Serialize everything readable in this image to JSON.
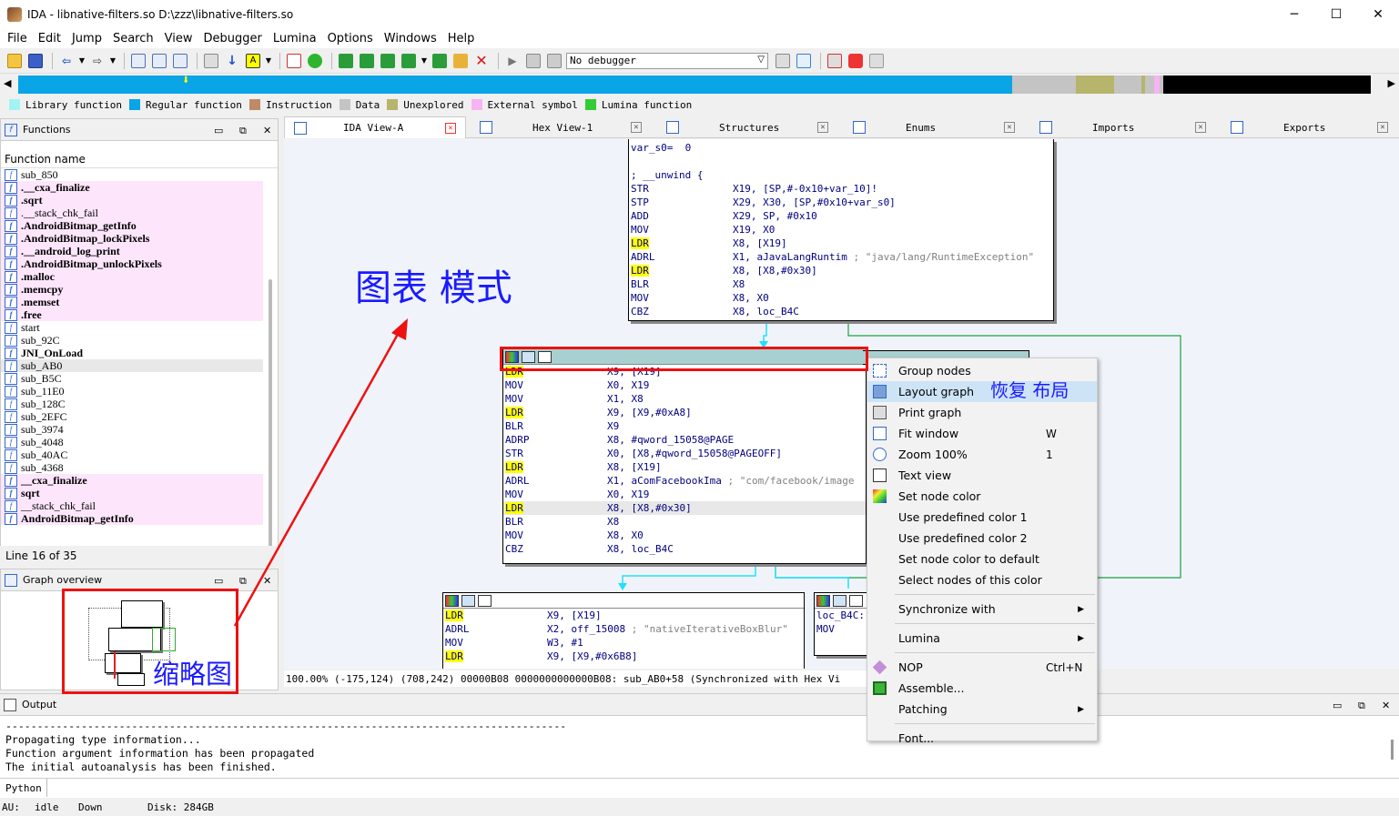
{
  "window": {
    "title": "IDA - libnative-filters.so D:\\zzz\\libnative-filters.so",
    "minimize": "─",
    "maximize": "☐",
    "close": "✕"
  },
  "menu": [
    "File",
    "Edit",
    "Jump",
    "Search",
    "View",
    "Debugger",
    "Lumina",
    "Options",
    "Windows",
    "Help"
  ],
  "toolbar": {
    "debugger_select": "No debugger"
  },
  "navband": {
    "colors": {
      "regular": "#0aa5e6",
      "library": "#a3f3f4",
      "data": "#c4c4c4",
      "unexplored": "#b7b46c",
      "external": "#f7b3f3",
      "black": "#000000"
    }
  },
  "legend": [
    {
      "label": "Library function",
      "color": "#a3f3f4"
    },
    {
      "label": "Regular function",
      "color": "#0aa5e6"
    },
    {
      "label": "Instruction",
      "color": "#c08a68"
    },
    {
      "label": "Data",
      "color": "#c4c4c4"
    },
    {
      "label": "Unexplored",
      "color": "#b7b46c"
    },
    {
      "label": "External symbol",
      "color": "#f7b3f3"
    },
    {
      "label": "Lumina function",
      "color": "#33cc33"
    }
  ],
  "tabs": [
    {
      "label": "IDA View-A",
      "active": true
    },
    {
      "label": "Hex View-1",
      "active": false
    },
    {
      "label": "Structures",
      "active": false
    },
    {
      "label": "Enums",
      "active": false
    },
    {
      "label": "Imports",
      "active": false
    },
    {
      "label": "Exports",
      "active": false
    }
  ],
  "functions_panel": {
    "title": "Functions",
    "column": "Function name",
    "items": [
      {
        "name": "sub_850",
        "style": ""
      },
      {
        "name": ".__cxa_finalize",
        "style": "pink b"
      },
      {
        "name": ".sqrt",
        "style": "pink b"
      },
      {
        "name": ".__stack_chk_fail",
        "style": "pink"
      },
      {
        "name": ".AndroidBitmap_getInfo",
        "style": "pink b"
      },
      {
        "name": ".AndroidBitmap_lockPixels",
        "style": "pink b"
      },
      {
        "name": ".__android_log_print",
        "style": "pink b"
      },
      {
        "name": ".AndroidBitmap_unlockPixels",
        "style": "pink b"
      },
      {
        "name": ".malloc",
        "style": "pink b"
      },
      {
        "name": ".memcpy",
        "style": "pink b"
      },
      {
        "name": ".memset",
        "style": "pink b"
      },
      {
        "name": ".free",
        "style": "pink b"
      },
      {
        "name": "start",
        "style": ""
      },
      {
        "name": "sub_92C",
        "style": ""
      },
      {
        "name": "JNI_OnLoad",
        "style": "b"
      },
      {
        "name": "sub_AB0",
        "style": "sel"
      },
      {
        "name": "sub_B5C",
        "style": ""
      },
      {
        "name": "sub_11E0",
        "style": ""
      },
      {
        "name": "sub_128C",
        "style": ""
      },
      {
        "name": "sub_2EFC",
        "style": ""
      },
      {
        "name": "sub_3974",
        "style": ""
      },
      {
        "name": "sub_4048",
        "style": ""
      },
      {
        "name": "sub_40AC",
        "style": ""
      },
      {
        "name": "sub_4368",
        "style": ""
      },
      {
        "name": "__cxa_finalize",
        "style": "pink b"
      },
      {
        "name": "sqrt",
        "style": "pink b"
      },
      {
        "name": "__stack_chk_fail",
        "style": "pink"
      },
      {
        "name": "AndroidBitmap_getInfo",
        "style": "pink b"
      }
    ],
    "line_info": "Line 16 of 35"
  },
  "overview_panel": {
    "title": "Graph overview"
  },
  "graph": {
    "node_top": {
      "lines": [
        {
          "mn": "var_s0=  0",
          "ops": "",
          "cmt": "",
          "hl": false,
          "raw": true
        },
        {
          "mn": "",
          "ops": "",
          "cmt": "",
          "hl": false,
          "raw": true
        },
        {
          "mn": "; __unwind {",
          "ops": "",
          "cmt": "",
          "hl": false,
          "raw": true
        },
        {
          "mn": "STR",
          "ops": "X19, [SP,#-0x10+var_10]!",
          "cmt": "",
          "hl": false
        },
        {
          "mn": "STP",
          "ops": "X29, X30, [SP,#0x10+var_s0]",
          "cmt": "",
          "hl": false
        },
        {
          "mn": "ADD",
          "ops": "X29, SP, #0x10",
          "cmt": "",
          "hl": false
        },
        {
          "mn": "MOV",
          "ops": "X19, X0",
          "cmt": "",
          "hl": false
        },
        {
          "mn": "LDR",
          "ops": "X8, [X19]",
          "cmt": "",
          "hl": true
        },
        {
          "mn": "ADRL",
          "ops": "X1, aJavaLangRuntim",
          "cmt": " ; \"java/lang/RuntimeException\"",
          "hl": false
        },
        {
          "mn": "LDR",
          "ops": "X8, [X8,#0x30]",
          "cmt": "",
          "hl": true
        },
        {
          "mn": "BLR",
          "ops": "X8",
          "cmt": "",
          "hl": false
        },
        {
          "mn": "MOV",
          "ops": "X8, X0",
          "cmt": "",
          "hl": false
        },
        {
          "mn": "CBZ",
          "ops": "X8, loc_B4C",
          "cmt": "",
          "hl": false
        }
      ]
    },
    "node_mid": {
      "lines": [
        {
          "mn": "LDR",
          "ops": "X9, [X19]",
          "cmt": "",
          "hl": true
        },
        {
          "mn": "MOV",
          "ops": "X0, X19",
          "cmt": "",
          "hl": false
        },
        {
          "mn": "MOV",
          "ops": "X1, X8",
          "cmt": "",
          "hl": false
        },
        {
          "mn": "LDR",
          "ops": "X9, [X9,#0xA8]",
          "cmt": "",
          "hl": true
        },
        {
          "mn": "BLR",
          "ops": "X9",
          "cmt": "",
          "hl": false
        },
        {
          "mn": "ADRP",
          "ops": "X8, #qword_15058@PAGE",
          "cmt": "",
          "hl": false
        },
        {
          "mn": "STR",
          "ops": "X0, [X8,#qword_15058@PAGEOFF]",
          "cmt": "",
          "hl": false
        },
        {
          "mn": "LDR",
          "ops": "X8, [X19]",
          "cmt": "",
          "hl": true
        },
        {
          "mn": "ADRL",
          "ops": "X1, aComFacebookIma",
          "cmt": " ; \"com/facebook/image",
          "hl": false
        },
        {
          "mn": "MOV",
          "ops": "X0, X19",
          "cmt": "",
          "hl": false
        },
        {
          "mn": "LDR",
          "ops": "X8, [X8,#0x30]",
          "cmt": "",
          "hl": true,
          "gray": true
        },
        {
          "mn": "BLR",
          "ops": "X8",
          "cmt": "",
          "hl": false
        },
        {
          "mn": "MOV",
          "ops": "X8, X0",
          "cmt": "",
          "hl": false
        },
        {
          "mn": "CBZ",
          "ops": "X8, loc_B4C",
          "cmt": "",
          "hl": false
        }
      ]
    },
    "node_bl": {
      "lines": [
        {
          "mn": "LDR",
          "ops": "X9, [X19]",
          "cmt": "",
          "hl": true
        },
        {
          "mn": "ADRL",
          "ops": "X2, off_15008",
          "cmt": " ; \"nativeIterativeBoxBlur\"",
          "hl": false
        },
        {
          "mn": "MOV",
          "ops": "W3, #1",
          "cmt": "",
          "hl": false
        },
        {
          "mn": "LDR",
          "ops": "X9, [X9,#0x6B8]",
          "cmt": "",
          "hl": true
        }
      ]
    },
    "node_br": {
      "lines": [
        {
          "mn": "loc_B4C:",
          "ops": "",
          "cmt": "",
          "hl": false,
          "raw": true
        },
        {
          "mn": "MOV",
          "ops": "",
          "cmt": "",
          "hl": false,
          "raw": true
        }
      ]
    },
    "status": "100.00% (-175,124) (708,242) 00000B08 0000000000000B08: sub_AB0+58 (Synchronized with Hex Vi"
  },
  "context_menu": [
    {
      "label": "Group nodes",
      "icon": "group-nodes-icon",
      "shortcut": "",
      "sub": false
    },
    {
      "label": "Layout graph",
      "icon": "layout-graph-icon",
      "shortcut": "",
      "sub": false,
      "hover": true
    },
    {
      "label": "Print graph",
      "icon": "printer-icon",
      "shortcut": "",
      "sub": false
    },
    {
      "label": "Fit window",
      "icon": "fit-window-icon",
      "shortcut": "W",
      "sub": false
    },
    {
      "label": "Zoom 100%",
      "icon": "zoom-icon",
      "shortcut": "1",
      "sub": false
    },
    {
      "label": "Text view",
      "icon": "text-view-icon",
      "shortcut": "",
      "sub": false
    },
    {
      "label": "Set node color",
      "icon": "color-palette-icon",
      "shortcut": "",
      "sub": false
    },
    {
      "label": "Use predefined color 1",
      "icon": "",
      "shortcut": "",
      "sub": false
    },
    {
      "label": "Use predefined color 2",
      "icon": "",
      "shortcut": "",
      "sub": false
    },
    {
      "label": "Set node color to default",
      "icon": "",
      "shortcut": "",
      "sub": false
    },
    {
      "label": "Select nodes of this color",
      "icon": "",
      "shortcut": "",
      "sub": false,
      "sep_after": true
    },
    {
      "label": "Synchronize with",
      "icon": "",
      "shortcut": "",
      "sub": true,
      "sep_after": true
    },
    {
      "label": "Lumina",
      "icon": "",
      "shortcut": "",
      "sub": true,
      "sep_after": true
    },
    {
      "label": "NOP",
      "icon": "nop-icon",
      "shortcut": "Ctrl+N",
      "sub": false
    },
    {
      "label": "Assemble...",
      "icon": "assemble-chip-icon",
      "shortcut": "",
      "sub": false
    },
    {
      "label": "Patching",
      "icon": "",
      "shortcut": "",
      "sub": true,
      "sep_after": true
    },
    {
      "label": "Font...",
      "icon": "",
      "shortcut": "",
      "sub": false
    }
  ],
  "output_panel": {
    "title": "Output",
    "text": "-----------------------------------------------------------------------------------------\nPropagating type information...\nFunction argument information has been propagated\nThe initial autoanalysis has been finished.",
    "python_label": "Python"
  },
  "statusbar": {
    "au": "AU:",
    "state": "idle",
    "dir": "Down",
    "disk": "Disk: 284GB"
  },
  "annotations": {
    "graph_mode": "图表 模式",
    "thumbnail": "缩略图",
    "restore_layout": "恢复 布局"
  }
}
